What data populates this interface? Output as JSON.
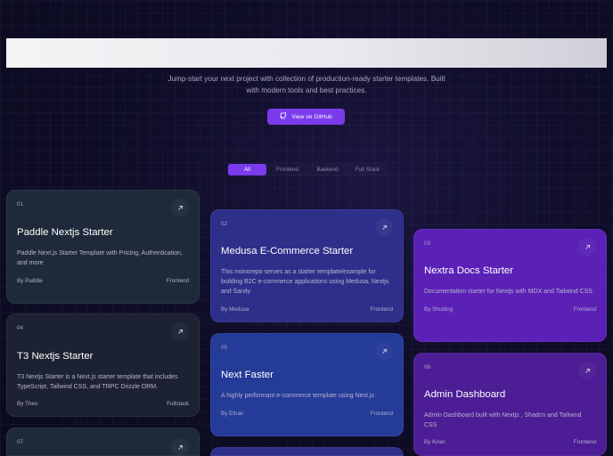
{
  "hero": {
    "subtitle": "Jump-start your next project with collection of production-ready starter templates. Built with modern tools and best practices.",
    "github_button": "View on GitHub"
  },
  "filters": [
    "All",
    "Frontend",
    "Backend",
    "Full Stack"
  ],
  "cards": [
    {
      "num": "01",
      "title": "Paddle Nextjs Starter",
      "desc": "Paddle Next.js Starter Template with Pricing, Authentication, and more",
      "author": "By Paddle",
      "tag": "Frontend"
    },
    {
      "num": "02",
      "title": "Medusa E-Commerce Starter",
      "desc": "This monorepo serves as a starter template/example for building B2C e-commerce applications using Medusa, Nextjs and Sanity",
      "author": "By Medusa",
      "tag": "Frontend"
    },
    {
      "num": "03",
      "title": "Nextra Docs Starter",
      "desc": "Documentation starter for Nextjs with MDX and Tailwind CSS",
      "author": "By Shuding",
      "tag": "Frontend"
    },
    {
      "num": "04",
      "title": "T3 Nextjs Starter",
      "desc": "T3 Nextjs Starter is a Next.js starter template that includes TypeScript, Tailwind CSS, and TRPC Drizzle ORM.",
      "author": "By Theo",
      "tag": "Fullstack"
    },
    {
      "num": "05",
      "title": "Next Faster",
      "desc": "A highly performant e-commerce template using Next.js",
      "author": "By Ethan",
      "tag": "Frontend"
    },
    {
      "num": "06",
      "title": "Admin Dashboard",
      "desc": "Admin Dashboard built with Nextjs , Shadcn and Tailwind CSS",
      "author": "By Kiran",
      "tag": "Frontend"
    },
    {
      "num": "07",
      "title": "",
      "desc": "",
      "author": "",
      "tag": ""
    }
  ],
  "colors": {
    "accent": "#7c3aed"
  }
}
